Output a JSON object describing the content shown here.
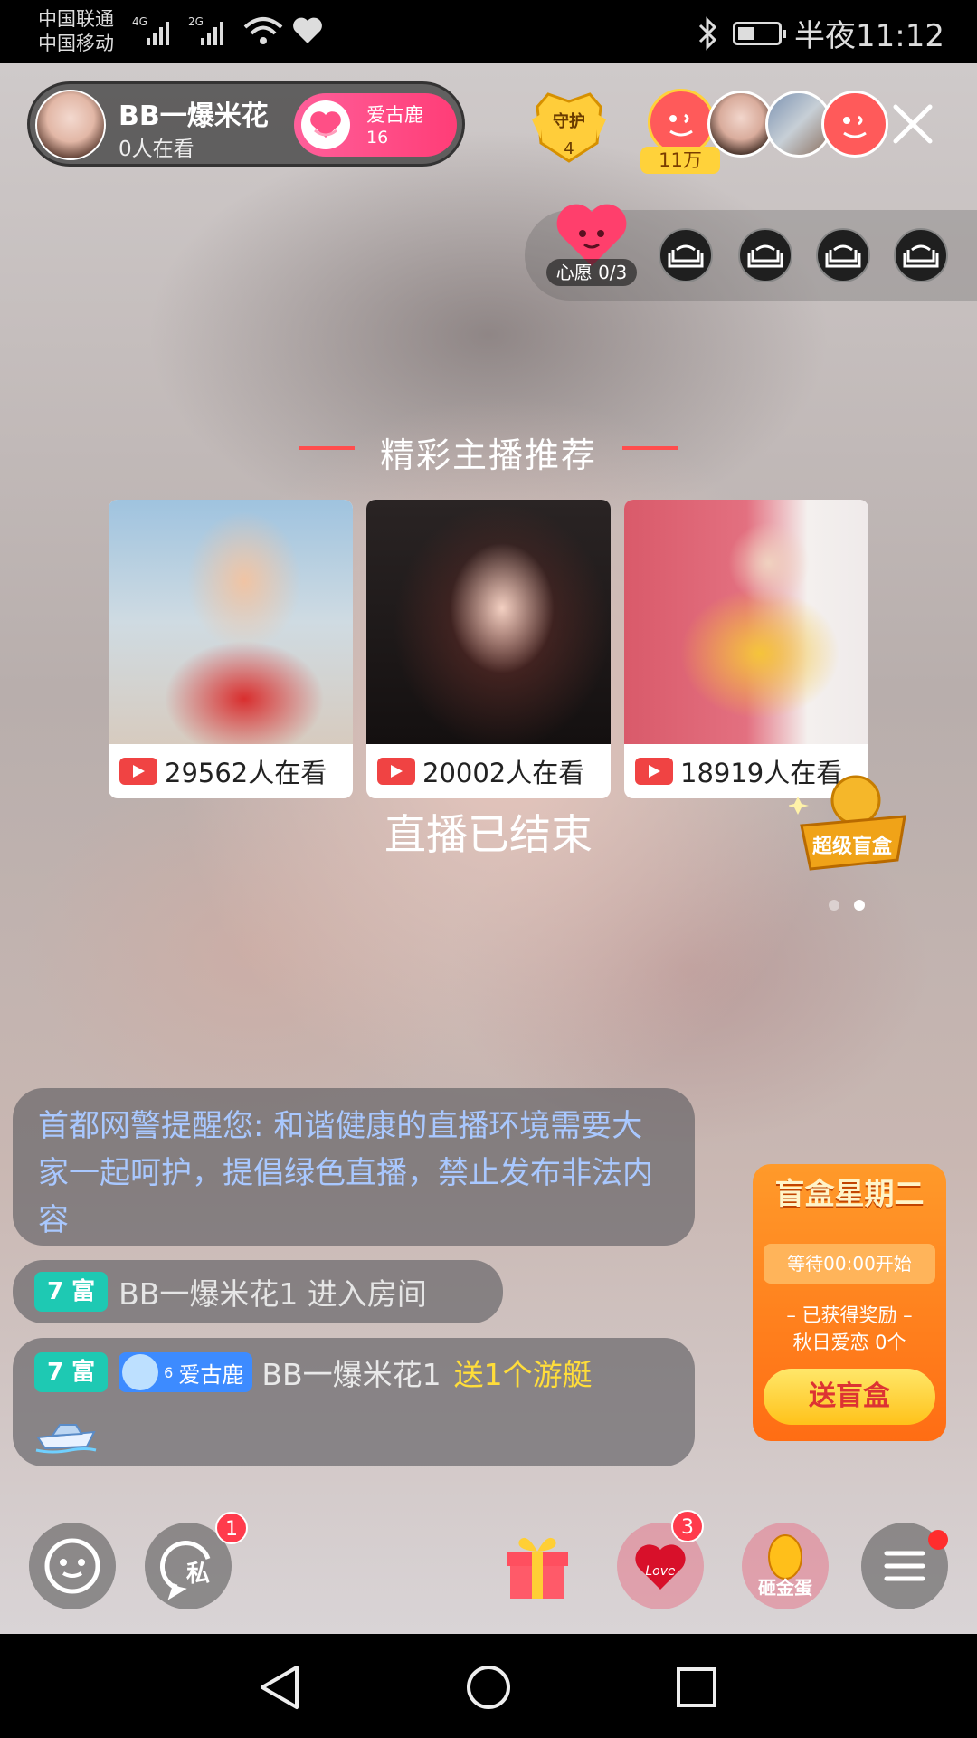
{
  "status_bar": {
    "carrier1": "中国联通",
    "carrier2": "中国移动",
    "net1": "4G",
    "net2": "2G",
    "time": "半夜11:12",
    "battery_level": 0.4
  },
  "streamer": {
    "name": "BB一爆米花",
    "viewers": "0人在看",
    "fan_club_label": "爱古鹿",
    "fan_club_count": "16"
  },
  "guard": {
    "label": "守护",
    "count": "4"
  },
  "top_fans": {
    "hot_badge": "11万"
  },
  "wish": {
    "label": "心愿 0/3"
  },
  "recommend": {
    "title": "精彩主播推荐",
    "cards": [
      {
        "count": "29562人在看"
      },
      {
        "count": "20002人在看"
      },
      {
        "count": "18919人在看"
      }
    ],
    "ended_text": "直播已结束",
    "blind_box_badge": "超级盲盒"
  },
  "chat": {
    "notice": "首都网警提醒您: 和谐健康的直播环境需要大家一起呵护，提倡绿色直播，禁止发布非法内容",
    "level_badge": "7 富",
    "enter_user": "BB一爆米花1 进入房间",
    "fan_badge_level": "6",
    "fan_badge_name": "爱古鹿",
    "gift_user": "BB一爆米花1",
    "gift_text": "送1个游艇"
  },
  "blind_box": {
    "title": "盲盒星期二",
    "wait": "等待00:00开始",
    "reward_label": "– 已获得奖励 –",
    "reward_value": "秋日爱恋 0个",
    "button": "送盲盒"
  },
  "bottom": {
    "private_label": "私",
    "private_badge": "1",
    "love_label": "Love",
    "love_badge": "3",
    "egg_label": "砸金蛋"
  },
  "colors": {
    "accent_pink": "#ff3d77",
    "red_line": "#ff4d4d",
    "level_teal": "#1ec9b3",
    "gift_yellow": "#ffdd3a",
    "blind_box_orange": "#ff7a1a"
  }
}
